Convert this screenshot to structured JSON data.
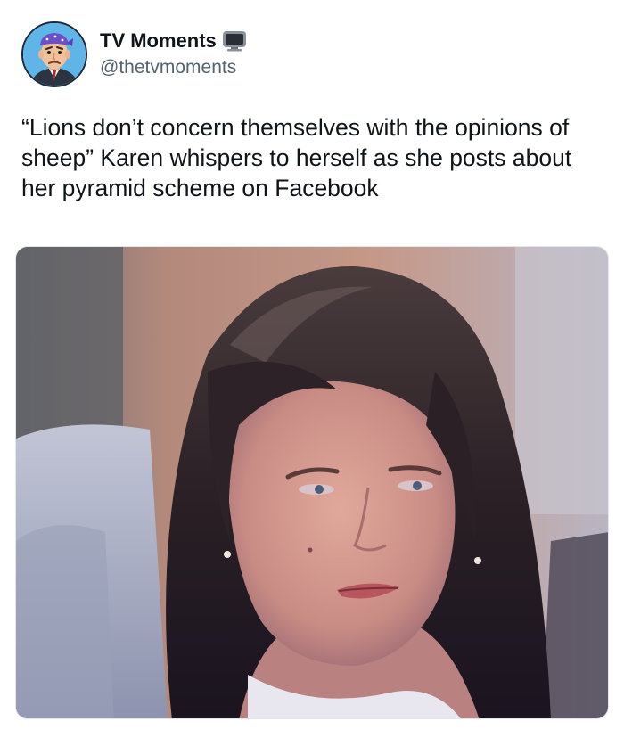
{
  "tweet": {
    "author": {
      "display_name": "TV Moments",
      "name_emoji_icon": "television-icon",
      "handle": "@thetvmoments",
      "avatar_icon": "cartoon-avatar-bandana"
    },
    "text": "“Lions don’t concern themselves with the opinions of sheep” Karen whispers to herself as she posts about her pyramid scheme on Facebook",
    "media": {
      "type": "photo"
    }
  },
  "colors": {
    "text_primary": "#0f1419",
    "text_secondary": "#536471",
    "avatar_background": "#5fb4e8",
    "bandana": "#6a4fc9"
  }
}
